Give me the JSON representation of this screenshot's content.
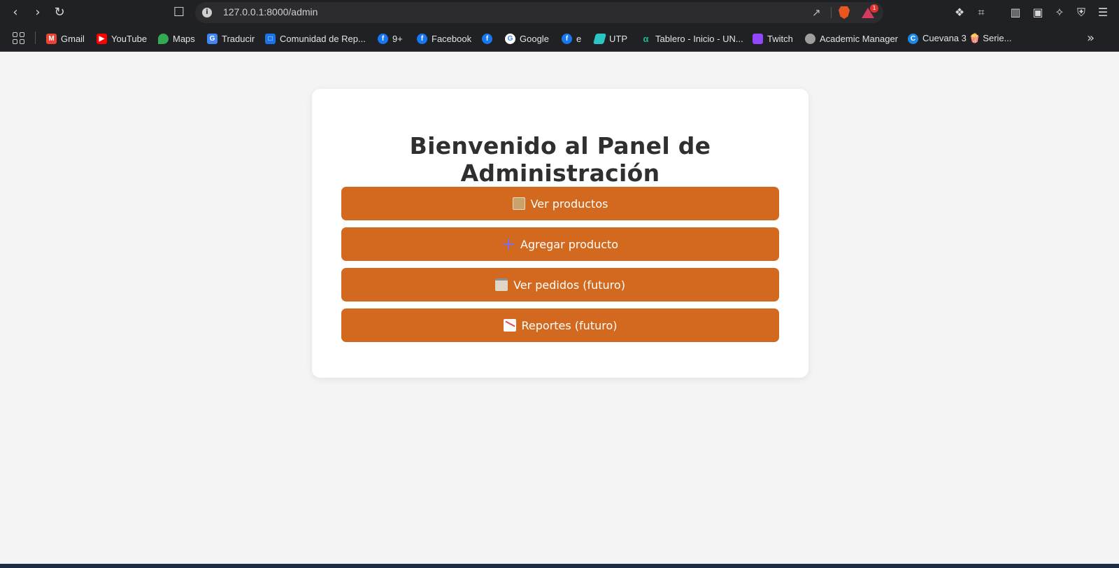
{
  "browser": {
    "url": "127.0.0.1:8000/admin",
    "rewards_count": "1",
    "bookmarks": [
      {
        "label": "Gmail",
        "icon": "gmail-icon",
        "color": "#ea4335"
      },
      {
        "label": "YouTube",
        "icon": "youtube-icon",
        "color": "#ff0000"
      },
      {
        "label": "Maps",
        "icon": "maps-icon",
        "color": "#34a853"
      },
      {
        "label": "Traducir",
        "icon": "translate-icon",
        "color": "#4285f4"
      },
      {
        "label": "Comunidad de Rep...",
        "icon": "calendar-icon",
        "color": "#1a73e8"
      },
      {
        "label": "9+",
        "icon": "facebook-icon",
        "color": "#1877f2"
      },
      {
        "label": "Facebook",
        "icon": "facebook-icon",
        "color": "#1877f2"
      },
      {
        "label": "",
        "icon": "facebook-icon",
        "color": "#1877f2"
      },
      {
        "label": "Google",
        "icon": "google-icon",
        "color": "#ffffff"
      },
      {
        "label": "e",
        "icon": "facebook-icon",
        "color": "#1877f2"
      },
      {
        "label": "UTP",
        "icon": "utp-icon",
        "color": "#2bc5c5"
      },
      {
        "label": "Tablero - Inicio - UN...",
        "icon": "tablero-icon",
        "color": "#1fb88b"
      },
      {
        "label": "Twitch",
        "icon": "twitch-icon",
        "color": "#9146ff"
      },
      {
        "label": "Academic Manager",
        "icon": "globe-icon",
        "color": "#9e9e9e"
      },
      {
        "label": "Cuevana 3 🍿 Serie...",
        "icon": "cuevana-icon",
        "color": "#1e88e5"
      }
    ]
  },
  "main": {
    "title": "Bienvenido al Panel de Administración",
    "buttons": [
      {
        "label": "Ver productos",
        "icon": "package-icon"
      },
      {
        "label": "Agregar producto",
        "icon": "plus-icon"
      },
      {
        "label": "Ver pedidos (futuro)",
        "icon": "clipboard-icon"
      },
      {
        "label": "Reportes (futuro)",
        "icon": "chart-decreasing-icon"
      }
    ]
  },
  "colors": {
    "accent": "#d2691e",
    "page_background": "#f4f4f4",
    "card_background": "#ffffff",
    "title_text": "#2f2f2f"
  }
}
